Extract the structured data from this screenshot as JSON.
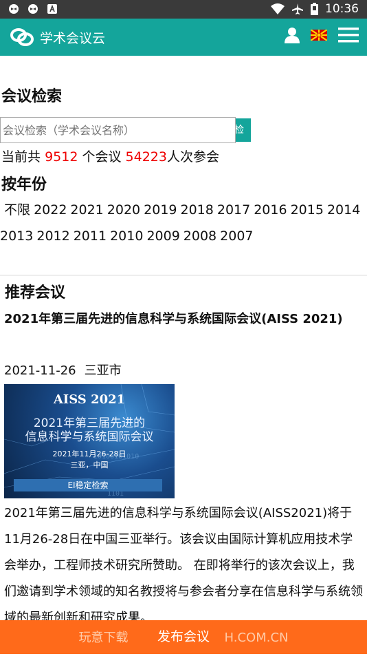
{
  "status_bar": {
    "time": "10:36",
    "icons": [
      "app-icon",
      "app-icon",
      "app-icon",
      "wifi-icon",
      "airplane-icon",
      "battery-icon"
    ]
  },
  "header": {
    "brand": "学术会议云",
    "icons": [
      "user-icon",
      "flag-icon",
      "menu-icon"
    ],
    "color": "#14a59b"
  },
  "search": {
    "title": "会议检索",
    "placeholder": "会议检索（学术会议名称）",
    "button_label": "检索",
    "count_prefix": "当前共",
    "conf_count": "9512",
    "count_mid": "个会议",
    "attendee_count": "54223",
    "count_suffix": "人次参会"
  },
  "years": {
    "title": "按年份",
    "items": [
      "不限",
      "2022",
      "2021",
      "2020",
      "2019",
      "2018",
      "2017",
      "2016",
      "2015",
      "2014",
      "2013",
      "2012",
      "2011",
      "2010",
      "2009",
      "2008",
      "2007"
    ]
  },
  "recommend": {
    "title": "推荐会议",
    "conf_title": "2021年第三届先进的信息科学与系统国际会议(AISS 2021)",
    "date": "2021-11-26",
    "location": "三亚市",
    "banner": {
      "title": "AISS 2021",
      "line1": "2021年第三届先进的",
      "line2": "信息科学与系统国际会议",
      "date": "2021年11月26-28日",
      "location": "三亚，中国",
      "badge": "EI稳定检索"
    },
    "description": "2021年第三届先进的信息科学与系统国际会议(AISS2021)将于11月26-28日在中国三亚举行。该会议由国际计算机应用技术学会举办，工程师技术研究所赞助。 在即将举行的该次会议上，我们邀请到学术领域的知名教授将与参会者分享在信息科学与系统领域的最新创新和研究成果。"
  },
  "bottom_bar": {
    "label": "发布会议",
    "color": "#ff6a1a"
  },
  "watermark": {
    "left": "玩意下载",
    "right": "H.COM.CN"
  }
}
